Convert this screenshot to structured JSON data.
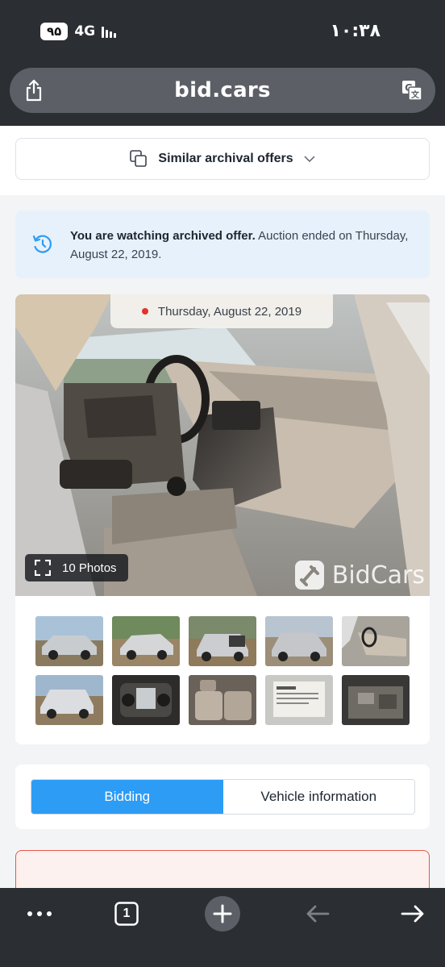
{
  "status_bar": {
    "battery": "۹۵",
    "network": "4G",
    "time": "۱۰:۳۸"
  },
  "browser": {
    "url": "bid.cars",
    "tab_count": "1",
    "share_icon": "share-icon",
    "translate_icon": "translate-icon"
  },
  "similar": {
    "label": "Similar archival offers",
    "icon": "copy-icon"
  },
  "archived_notice": {
    "bold": "You are watching archived offer.",
    "text": " Auction ended on Thursday, August 22, 2019."
  },
  "gallery": {
    "date": "Thursday, August 22, 2019",
    "photos_label": "10 Photos",
    "watermark": "BidCars",
    "thumbnails": [
      "exterior-front-left",
      "exterior-front-right",
      "exterior-rear-left",
      "exterior-rear-right",
      "interior-dash",
      "exterior-side-left",
      "instrument-cluster",
      "rear-seats",
      "window-sticker",
      "engine-bay"
    ]
  },
  "tabs": [
    {
      "label": "Bidding",
      "active": true
    },
    {
      "label": "Vehicle information",
      "active": false
    }
  ],
  "colors": {
    "accent": "#2d9cf5",
    "chrome": "#2b2e33",
    "notice_bg": "#e6f1fb",
    "alert_border": "#e4574b"
  }
}
